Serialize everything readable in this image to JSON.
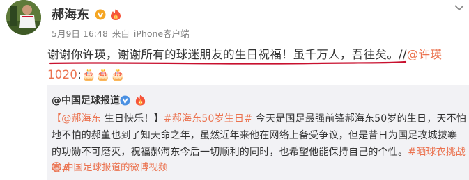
{
  "post": {
    "username": "郝海东",
    "date": "5月9日 16:48",
    "source_prefix": "来自",
    "source_name": "iPhone客户端",
    "text_part1": "谢谢你许瑛，谢谢所有的球迷朋友的生日祝福！虽千万人，吾往矣。//",
    "mention": "@许瑛",
    "mention_suffix": "1020",
    "text_end": ":🎂🎂🎂"
  },
  "repost": {
    "username": "@中国足球报道",
    "mention": "【@郝海东",
    "greeting": " 生日快乐！】",
    "hashtag1": "#郝海东50岁生日#",
    "body": " 今天是国足最强前锋郝海东50岁的生日，天不怕地不怕的郝董也到了知天命之年，虽然近年来他在网络上备受争议，但是昔日为国足攻城拔寨的功勋不可磨灭，祝福郝海东今后一切顺利的同时，也希望他能保持自己的个性。",
    "hashtag2": "#晒球衣挑战赛#",
    "video_link": "中国足球报道的微博视频"
  },
  "colors": {
    "link": "#eb7350",
    "text": "#333333",
    "meta": "#808080",
    "repost_bg": "#f2f2f5",
    "verified": "#f5a623",
    "underline": "#c8102e"
  },
  "icons": {
    "verified": "verified-v-icon",
    "fire": "fire-badge-icon",
    "menu": "chevron-down-icon",
    "video": "play-video-icon"
  }
}
